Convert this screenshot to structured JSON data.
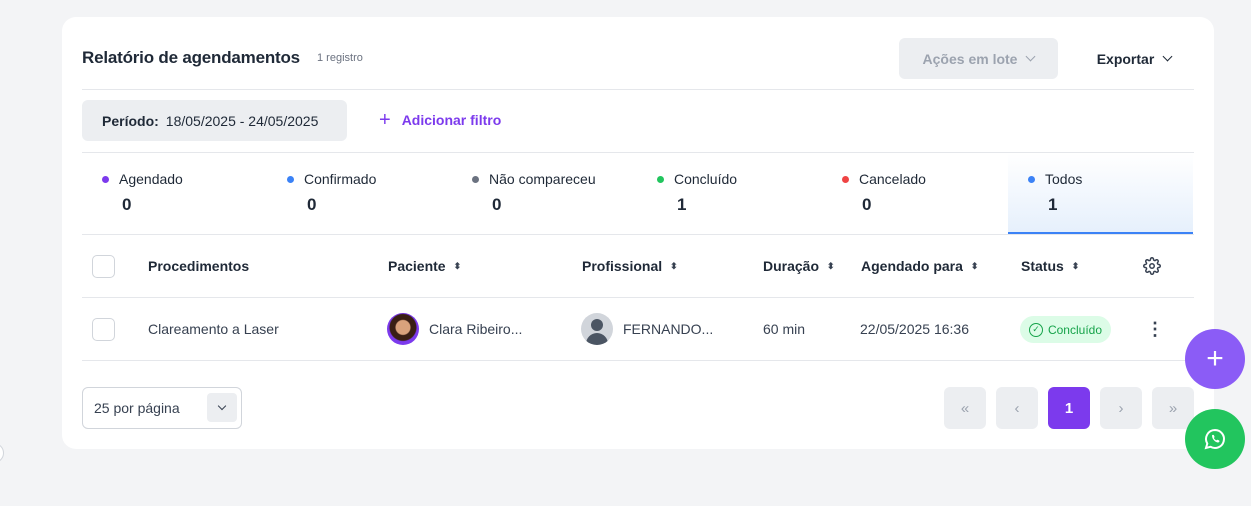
{
  "header": {
    "title": "Relatório de agendamentos",
    "count": "1 registro",
    "bulk_actions_label": "Ações em lote",
    "export_label": "Exportar"
  },
  "filters": {
    "period_label": "Período:",
    "period_value": "18/05/2025 - 24/05/2025",
    "add_filter_label": "Adicionar filtro"
  },
  "status_tabs": [
    {
      "label": "Agendado",
      "count": "0",
      "color": "#7c3aed"
    },
    {
      "label": "Confirmado",
      "count": "0",
      "color": "#3b82f6"
    },
    {
      "label": "Não compareceu",
      "count": "0",
      "color": "#6b7280"
    },
    {
      "label": "Concluído",
      "count": "1",
      "color": "#22c55e"
    },
    {
      "label": "Cancelado",
      "count": "0",
      "color": "#ef4444"
    },
    {
      "label": "Todos",
      "count": "1",
      "color": "#3b82f6",
      "active": true
    }
  ],
  "table": {
    "columns": [
      "Procedimentos",
      "Paciente",
      "Profissional",
      "Duração",
      "Agendado para",
      "Status"
    ],
    "rows": [
      {
        "procedure": "Clareamento a Laser",
        "patient": "Clara Ribeiro...",
        "professional": "FERNANDO...",
        "duration": "60 min",
        "scheduled_for": "22/05/2025 16:36",
        "status": "Concluído"
      }
    ]
  },
  "pagination": {
    "per_page": "25 por página",
    "current_page": "1",
    "first": "«",
    "prev": "‹",
    "next": "›",
    "last": "»"
  },
  "icons": {
    "sort": "⬍",
    "plus": "+",
    "kebab": "⋮",
    "check": "✓"
  },
  "colors": {
    "accent": "#7c3aed",
    "whatsapp": "#22c55e",
    "status_done": "#16a34a"
  }
}
